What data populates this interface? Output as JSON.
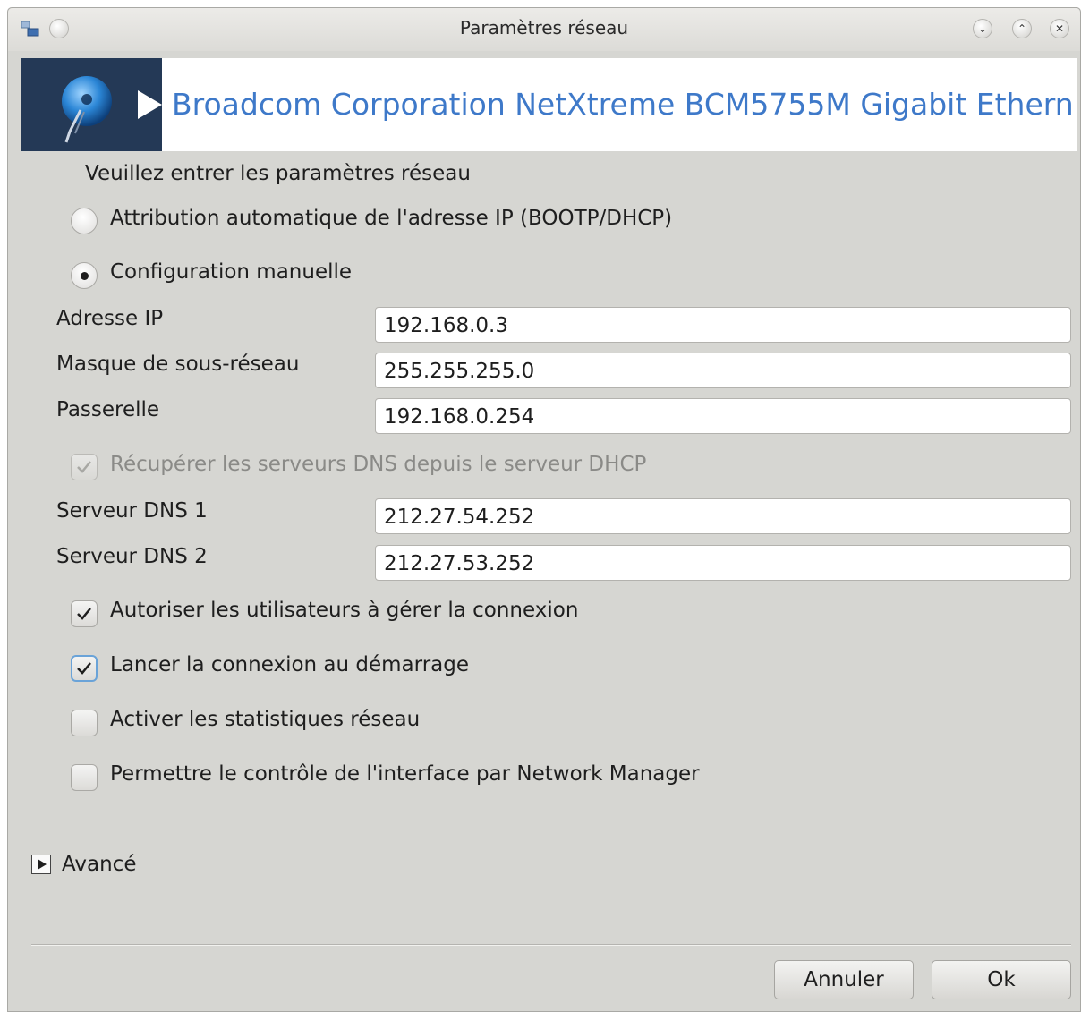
{
  "window": {
    "title": "Paramètres réseau",
    "controls": [
      "minimize-icon",
      "maximize-icon",
      "close-icon"
    ]
  },
  "banner": {
    "title": "Broadcom Corporation NetXtreme BCM5755M Gigabit Ethern",
    "icon": "network-globe-icon",
    "accent_color": "#3e79c9",
    "bg_color": "#243956"
  },
  "form": {
    "prompt": "Veuillez entrer les paramètres réseau",
    "radio_auto": {
      "label": "Attribution automatique de l'adresse IP (BOOTP/DHCP)",
      "selected": false
    },
    "radio_manual": {
      "label": "Configuration manuelle",
      "selected": true
    },
    "ip": {
      "label": "Adresse IP",
      "value": "192.168.0.3"
    },
    "netmask": {
      "label": "Masque de sous-réseau",
      "value": "255.255.255.0"
    },
    "gateway": {
      "label": "Passerelle",
      "value": "192.168.0.254"
    },
    "dns_from_dhcp": {
      "label": "Récupérer les serveurs DNS depuis le serveur DHCP",
      "checked": true,
      "enabled": false
    },
    "dns1": {
      "label": "Serveur DNS 1",
      "value": "212.27.54.252"
    },
    "dns2": {
      "label": "Serveur DNS 2",
      "value": "212.27.53.252"
    },
    "allow_users": {
      "label": "Autoriser les utilisateurs à gérer la connexion",
      "checked": true
    },
    "start_at_boot": {
      "label": "Lancer la connexion au démarrage",
      "checked": true
    },
    "enable_stats": {
      "label": "Activer les statistiques réseau",
      "checked": false
    },
    "network_manager": {
      "label": "Permettre le contrôle de l'interface par Network Manager",
      "checked": false
    },
    "advanced": {
      "label": "Avancé",
      "expanded": false
    }
  },
  "buttons": {
    "cancel": "Annuler",
    "ok": "Ok"
  }
}
